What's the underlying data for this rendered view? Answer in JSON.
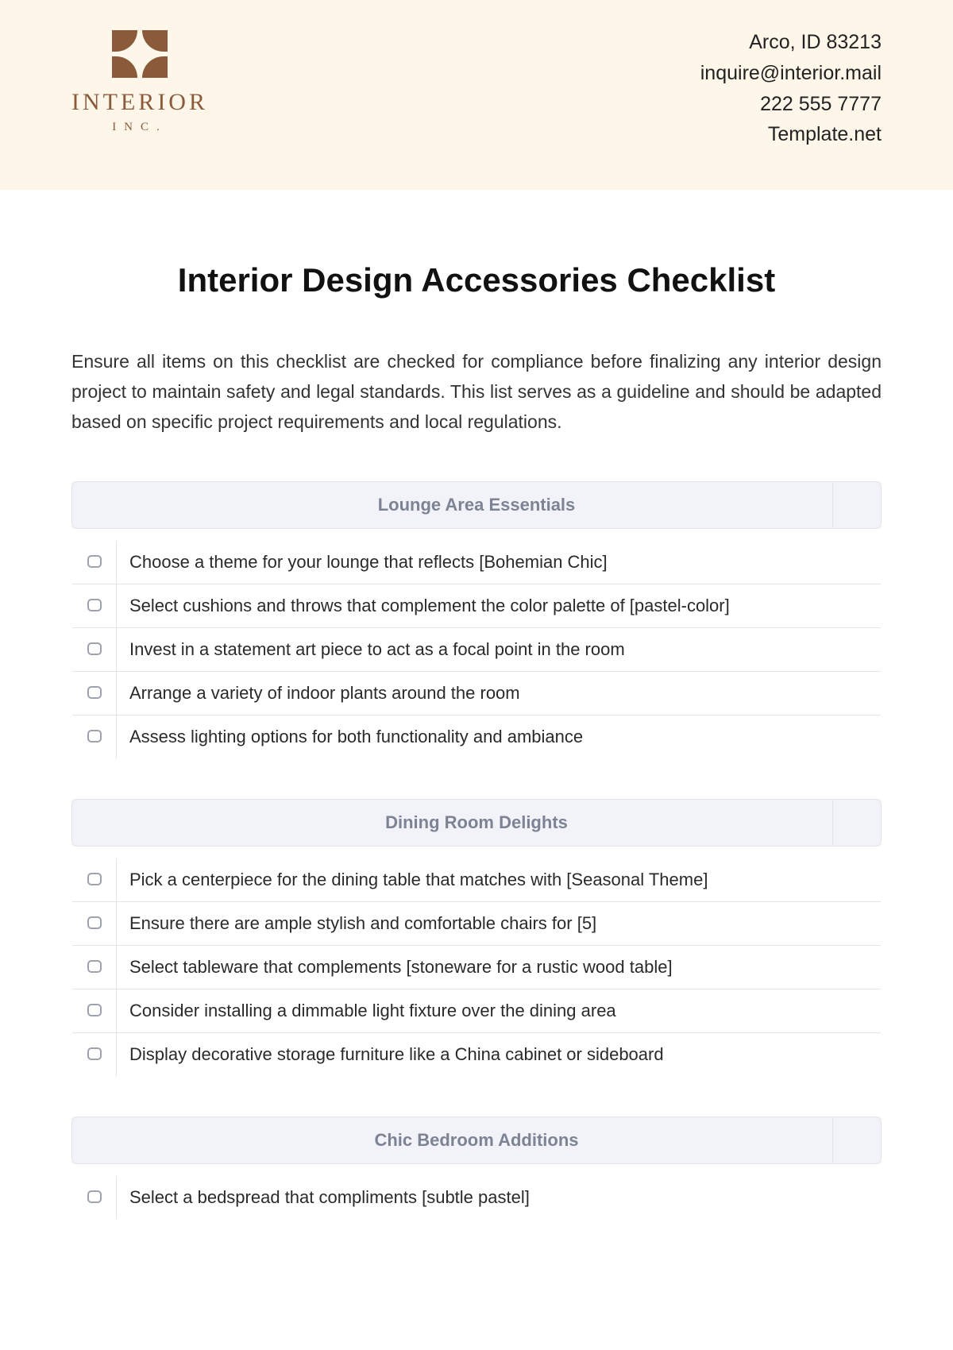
{
  "header": {
    "logo_name": "INTERIOR",
    "logo_sub": "INC.",
    "contact": {
      "address": "Arco, ID 83213",
      "email": "inquire@interior.mail",
      "phone": "222 555 7777",
      "site": "Template.net"
    }
  },
  "title": "Interior Design Accessories Checklist",
  "intro": "Ensure all items on this checklist are checked for compliance before finalizing any interior design project to maintain safety and legal standards. This list serves as a guideline and should be adapted based on specific project requirements and local regulations.",
  "sections": [
    {
      "heading": "Lounge Area Essentials",
      "items": [
        "Choose a theme for your lounge that reflects [Bohemian Chic]",
        "Select cushions and throws that complement the color palette of [pastel-color]",
        "Invest in a statement art piece to act as a focal point in the room",
        "Arrange a variety of indoor plants around the room",
        "Assess lighting options for both functionality and ambiance"
      ]
    },
    {
      "heading": "Dining Room Delights",
      "items": [
        "Pick a centerpiece for the dining table that matches with [Seasonal Theme]",
        "Ensure there are ample stylish and comfortable chairs for [5]",
        "Select tableware that complements [stoneware for a rustic wood table]",
        "Consider installing a dimmable light fixture over the dining area",
        "Display decorative storage furniture like a China cabinet or sideboard"
      ]
    },
    {
      "heading": "Chic Bedroom Additions",
      "items": [
        "Select a bedspread that compliments [subtle pastel]"
      ]
    }
  ]
}
